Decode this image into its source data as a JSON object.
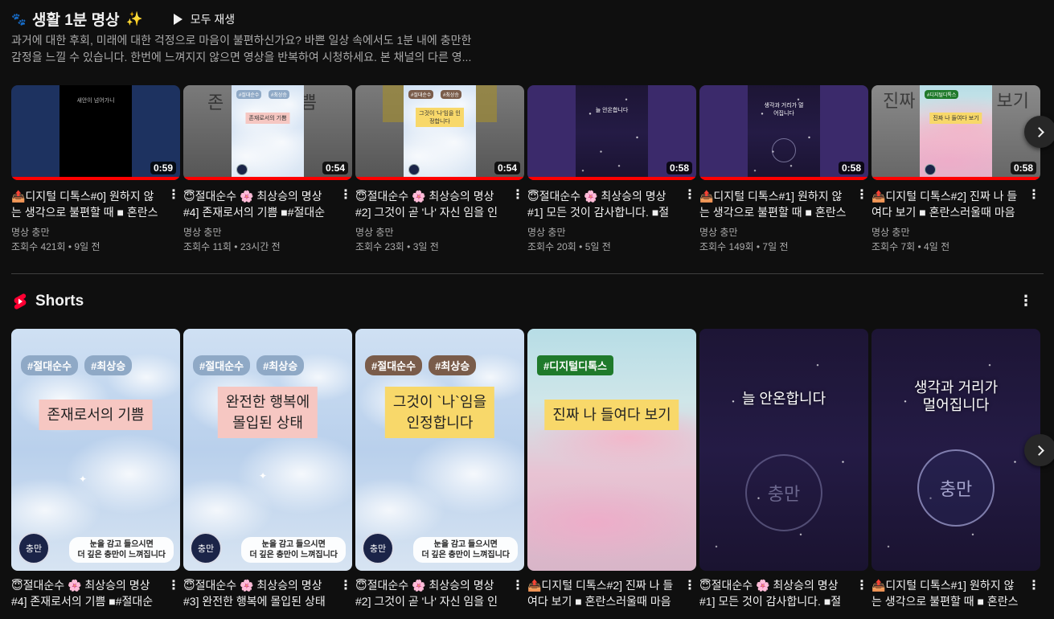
{
  "shelf": {
    "icon": "paw-icon",
    "title": "생활 1분 명상",
    "sparkle": "✨",
    "play_all": "모두 재생",
    "description_line1": "과거에 대한 후회, 미래에 대한 걱정으로 마음이 불편하신가요? 바쁜 일상 속에서도 1분 내에 충만한",
    "description_line2": "감정을 느낄 수 있습니다. 한번에 느껴지지 않으면 영상을 반복하여 시청하세요. 본 채널의 다른 영..."
  },
  "videos": [
    {
      "title": "📤디지털 디톡스#0] 원하지 않는 생각으로 불편할 때 ■ 혼란스러울 때",
      "channel": "명상 충만",
      "views": "조회수 421회",
      "age": "9일 전",
      "duration": "0:59",
      "thumb_text": "새안이 넘어가니",
      "menu": "⋮"
    },
    {
      "title": "😇절대순수 🌸 최상승의 명상 #4] 존재로서의 기쁨 ■#절대순수",
      "channel": "명상 충만",
      "views": "조회수 11회",
      "age": "23시간 전",
      "duration": "0:54",
      "thumb_chip1": "#절대순수",
      "thumb_chip2": "#최상승",
      "thumb_text": "존재로서의 기쁨",
      "side_left": "존",
      "side_right": "쁨",
      "menu": "⋮"
    },
    {
      "title": "😇절대순수 🌸 최상승의 명상 #2] 그것이 곧 '나' 자신 임을 인정합니다",
      "channel": "명상 충만",
      "views": "조회수 23회",
      "age": "3일 전",
      "duration": "0:54",
      "thumb_chip1": "#절대순수",
      "thumb_chip2": "#최상승",
      "thumb_text": "그것이 '나'임을 인정합니다",
      "menu": "⋮"
    },
    {
      "title": "😇절대순수 🌸 최상승의 명상 #1] 모든 것이 감사합니다. ■절대순수",
      "channel": "명상 충만",
      "views": "조회수 20회",
      "age": "5일 전",
      "duration": "0:58",
      "thumb_text": "늘 안온합니다",
      "menu": "⋮"
    },
    {
      "title": "📤디지털 디톡스#1] 원하지 않는 생각으로 불편할 때 ■ 혼란스러울 때",
      "channel": "명상 충만",
      "views": "조회수 149회",
      "age": "7일 전",
      "duration": "0:58",
      "thumb_text": "생각과 거리가 멀어집니다",
      "menu": "⋮"
    },
    {
      "title": "📤디지털 디톡스#2] 진짜 나 들여다 보기 ■ 혼란스러울때 마음챙김",
      "channel": "명상 충만",
      "views": "조회수 7회",
      "age": "4일 전",
      "duration": "0:58",
      "thumb_chip1": "#디지털디톡스",
      "thumb_text": "진짜 나 들여다 보기",
      "side_left": "진짜",
      "side_right": "보기",
      "menu": "⋮"
    }
  ],
  "shorts_section": {
    "title": "Shorts",
    "icon": "shorts-logo-icon",
    "menu": "⋮"
  },
  "shorts": [
    {
      "title": "😇절대순수 🌸 최상승의 명상 #4] 존재로서의 기쁨 ■#절대순수",
      "chip1": "#절대순수",
      "chip2": "#최상승",
      "banner": "존재로서의 기쁨",
      "caption1": "눈을 감고 들으시면",
      "caption2": "더 깊은 충만이 느껴집니다",
      "seal": "충만",
      "menu": "⋮"
    },
    {
      "title": "😇절대순수 🌸 최상승의 명상 #3] 완전한 행복에 몰입된 상태",
      "chip1": "#절대순수",
      "chip2": "#최상승",
      "banner1": "완전한 행복에",
      "banner2": "몰입된 상태",
      "caption1": "눈을 감고 들으시면",
      "caption2": "더 깊은 충만이 느껴집니다",
      "seal": "충만",
      "menu": "⋮"
    },
    {
      "title": "😇절대순수 🌸 최상승의 명상 #2] 그것이 곧 '나' 자신 임을 인정합니다",
      "chip1": "#절대순수",
      "chip2": "#최상승",
      "banner1": "그것이 `나`임을",
      "banner2": "인정합니다",
      "caption1": "눈을 감고 들으시면",
      "caption2": "더 깊은 충만이 느껴집니다",
      "seal": "충만",
      "menu": "⋮"
    },
    {
      "title": "📤디지털 디톡스#2] 진짜 나 들여다 보기 ■ 혼란스러울때 마음챙김",
      "chip1": "#디지털디톡스",
      "banner": "진짜 나 들여다 보기",
      "menu": "⋮"
    },
    {
      "title": "😇절대순수 🌸 최상승의 명상 #1] 모든 것이 감사합니다. ■절대순수",
      "text1": "늘 안온합니다",
      "ring": "충만",
      "menu": "⋮"
    },
    {
      "title": "📤디지털 디톡스#1] 원하지 않는 생각으로 불편할 때 ■ 혼란스러울 때",
      "text1": "생각과 거리가",
      "text2": "멀어집니다",
      "ring": "충만",
      "menu": "⋮"
    }
  ],
  "colors": {
    "background": "#0f0f0f",
    "progress": "#ff0000",
    "secondary_text": "#aaaaaa",
    "shorts_red": "#ff0033"
  }
}
